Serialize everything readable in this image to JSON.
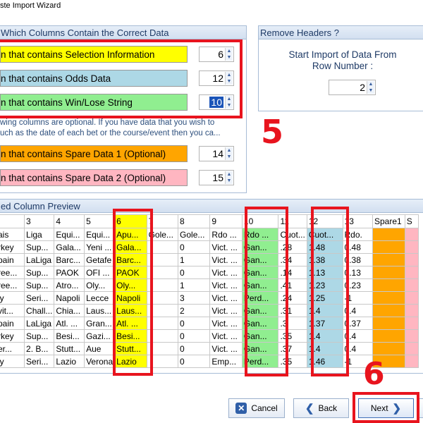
{
  "window": {
    "title": "ste Import Wizard"
  },
  "columns_panel": {
    "title": "Which Columns Contain the Correct Data",
    "selection": {
      "label": "n that contains Selection Information",
      "value": "6",
      "color": "#ffff00"
    },
    "odds": {
      "label": "n that contains Odds Data",
      "value": "12",
      "color": "#add8e6"
    },
    "winlose": {
      "label": "n that contains Win/Lose String",
      "value": "10",
      "color": "#90ee90"
    },
    "optional_note_1": "wing columns are optional. If you have data that you wish to",
    "optional_note_2": "uch as the date of each bet or the course/event then you ca...",
    "spare1": {
      "label": "n that contains Spare Data 1 (Optional)",
      "value": "14",
      "color": "#ffa500"
    },
    "spare2": {
      "label": "n that contains Spare Data 2 (Optional)",
      "value": "15",
      "color": "#ffb6c1"
    }
  },
  "headers_panel": {
    "title": "Remove Headers ?",
    "label_line1": "Start Import of Data From",
    "label_line2": "Row Number :",
    "value": "2"
  },
  "preview": {
    "title": "ed Column Preview",
    "headers": [
      "",
      "3",
      "4",
      "5",
      "6",
      "7",
      "8",
      "9",
      "10",
      "11",
      "12",
      "13",
      "Spare1",
      "S"
    ],
    "rows": [
      [
        "ais",
        "Liga",
        "Equi...",
        "Equi...",
        "Apu...",
        "Gole...",
        "Gole...",
        "Rdo ...",
        "Rdo ...",
        "Cuot...",
        "Cuot...",
        "Rdo.",
        "",
        ""
      ],
      [
        "rkey",
        "Sup...",
        "Gala...",
        "Yeni ...",
        "Gala...",
        "",
        "0",
        "Vict. ...",
        "Gan...",
        ".28",
        "1.48",
        "0.48",
        "",
        ""
      ],
      [
        "pain",
        "LaLiga",
        "Barc...",
        "Getafe",
        "Barc...",
        "",
        "1",
        "Vict. ...",
        "Gan...",
        ".34",
        "1.38",
        "0.38",
        "",
        ""
      ],
      [
        "ree...",
        "Sup...",
        "PAOK",
        "OFI ...",
        "PAOK",
        "",
        "0",
        "Vict. ...",
        "Gan...",
        ".14",
        "1.13",
        "0.13",
        "",
        ""
      ],
      [
        "ree...",
        "Sup...",
        "Atro...",
        "Oly...",
        "Oly...",
        "",
        "1",
        "Vict. ...",
        "Gan...",
        ".41",
        "1.23",
        "0.23",
        "",
        ""
      ],
      [
        "ly",
        "Seri...",
        "Napoli",
        "Lecce",
        "Napoli",
        "",
        "3",
        "Vict. ...",
        "Perd...",
        ".24",
        "1.25",
        "-1",
        "",
        ""
      ],
      [
        "vit...",
        "Chall...",
        "Chia...",
        "Laus...",
        "Laus...",
        "",
        "2",
        "Vict. ...",
        "Gan...",
        ".31",
        "1.4",
        "0.4",
        "",
        ""
      ],
      [
        "pain",
        "LaLiga",
        "Atl. ...",
        "Gran...",
        "Atl. ...",
        "",
        "0",
        "Vict. ...",
        "Gan...",
        ".3",
        "1.37",
        "0.37",
        "",
        ""
      ],
      [
        "rkey",
        "Sup...",
        "Besi...",
        "Gazi...",
        "Besi...",
        "",
        "0",
        "Vict. ...",
        "Gan...",
        ".35",
        "1.4",
        "0.4",
        "",
        ""
      ],
      [
        "er...",
        "2. B...",
        "Stutt...",
        "Aue",
        "Stutt...",
        "",
        "0",
        "Vict. ...",
        "Gan...",
        ".37",
        "1.4",
        "0.4",
        "",
        ""
      ],
      [
        "ly",
        "Seri...",
        "Lazio",
        "Verona",
        "Lazio",
        "",
        "0",
        "Emp...",
        "Perd...",
        ".35",
        "1.46",
        "-1",
        "",
        ""
      ]
    ]
  },
  "annotations": {
    "five": "5",
    "six": "6"
  },
  "buttons": {
    "cancel": "Cancel",
    "back": "Back",
    "next": "Next"
  },
  "colors": {
    "accent_red": "#e8141e",
    "selection": "#ffff00",
    "odds": "#add8e6",
    "winlose": "#90ee90",
    "spare1": "#ffa500",
    "spare2": "#ffb6c1"
  }
}
